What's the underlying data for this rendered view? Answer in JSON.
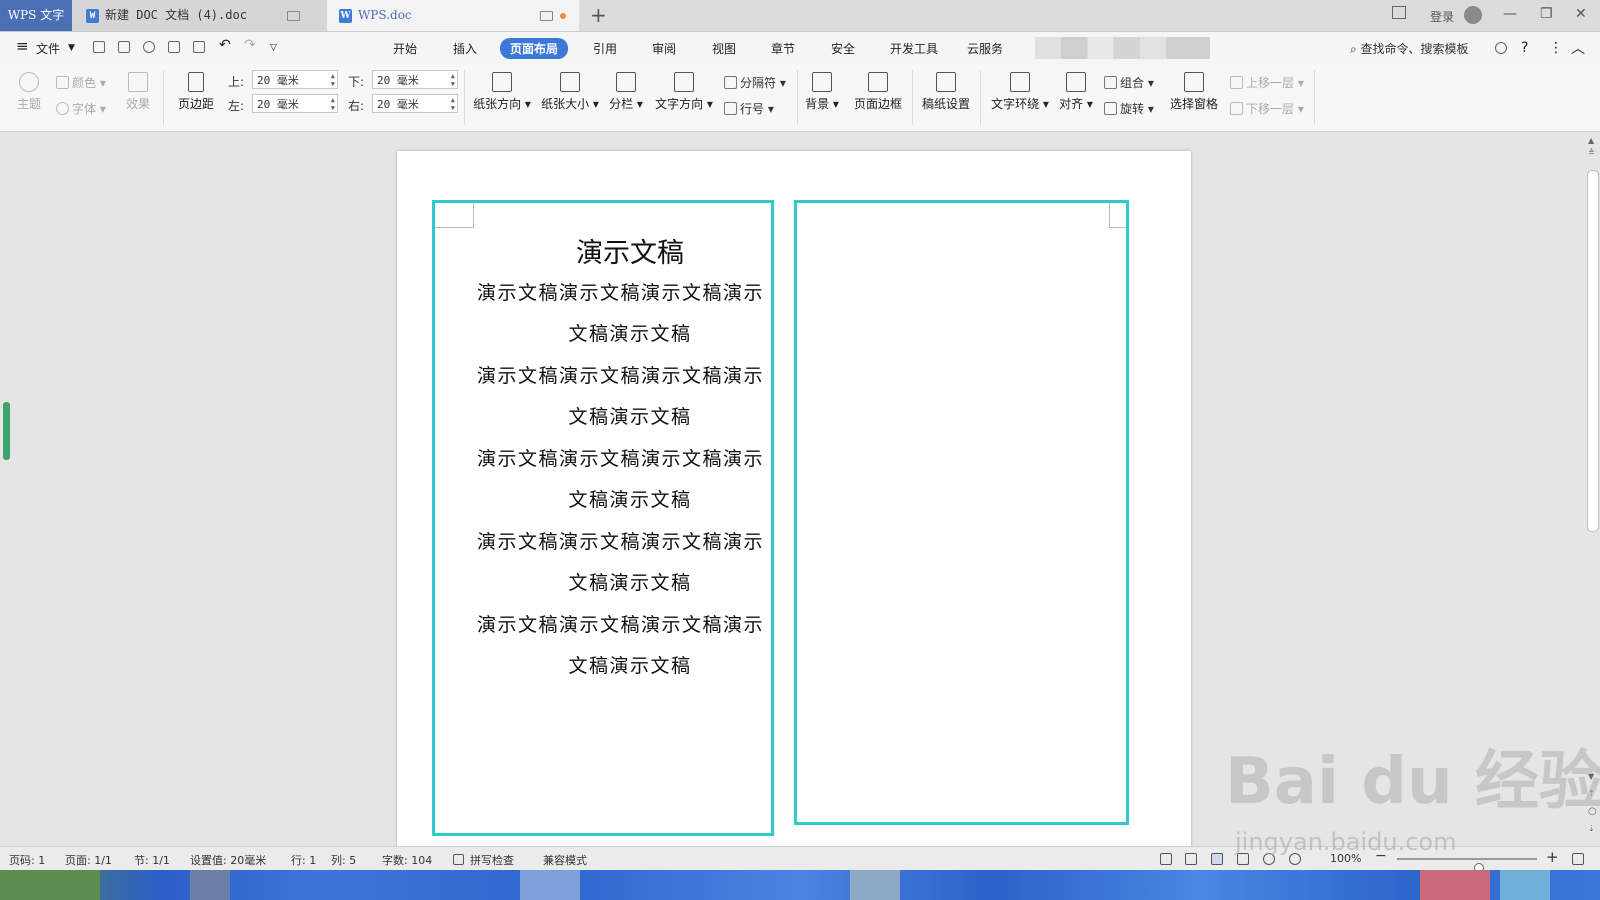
{
  "tabs": {
    "app": "WPS 文字",
    "doc1": "新建 DOC 文档 (4).doc",
    "doc2": "WPS.doc",
    "doc_badge": "W"
  },
  "window": {
    "login": "登录"
  },
  "menu": {
    "file": "文件",
    "items": [
      "开始",
      "插入",
      "页面布局",
      "引用",
      "审阅",
      "视图",
      "章节",
      "安全",
      "开发工具",
      "云服务"
    ],
    "active": "页面布局",
    "search": "查找命令、搜索模板"
  },
  "ribbon": {
    "theme": "主题",
    "colors": "颜色",
    "fonts": "字体",
    "effects": "效果",
    "margins": "页边距",
    "top_label": "上:",
    "top_value": "20 毫米",
    "bottom_label": "下:",
    "bottom_value": "20 毫米",
    "left_label": "左:",
    "left_value": "20 毫米",
    "right_label": "右:",
    "right_value": "20 毫米",
    "orientation": "纸张方向",
    "size": "纸张大小",
    "columns": "分栏",
    "text_direction": "文字方向",
    "breaks": "分隔符",
    "line_numbers": "行号",
    "background": "背景",
    "page_border": "页面边框",
    "manuscript": "稿纸设置",
    "wrap": "文字环绕",
    "align": "对齐",
    "group": "组合",
    "rotate": "旋转",
    "selection_pane": "选择窗格",
    "bring_forward": "上移一层",
    "send_backward": "下移一层"
  },
  "document": {
    "title": "演示文稿",
    "long_line": "演示文稿演示文稿演示文稿演示",
    "short_line": "文稿演示文稿"
  },
  "status": {
    "page_code": "页码: 1",
    "page": "页面: 1/1",
    "section": "节: 1/1",
    "setting": "设置值: 20毫米",
    "row": "行: 1",
    "col": "列: 5",
    "words": "字数: 104",
    "spell": "拼写检查",
    "compat": "兼容模式",
    "zoom": "100%",
    "zoom_level": 1.0
  },
  "watermark": {
    "brand": "Bai du 经验",
    "url": "jingyan.baidu.com"
  },
  "colors": {
    "accent": "#3c78d8",
    "border_cyan": "#2fcaca"
  }
}
